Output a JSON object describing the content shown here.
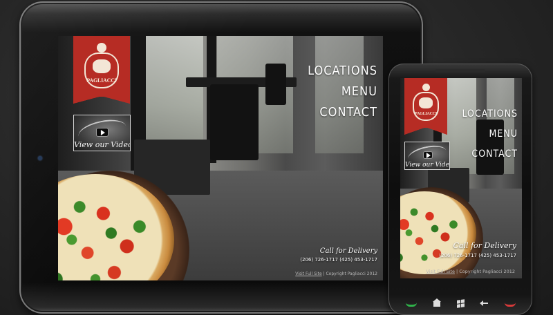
{
  "brand": {
    "name": "PAGLIACCI",
    "accent": "#b62c24"
  },
  "video": {
    "label": "View our Video",
    "icon": "play-icon"
  },
  "nav": {
    "items": [
      "LOCATIONS",
      "MENU",
      "CONTACT"
    ]
  },
  "delivery": {
    "title": "Call for Delivery",
    "phones": "(206) 726-1717  (425) 453-1717"
  },
  "footer": {
    "link": "Visit Full Site",
    "separator": " | ",
    "copyright": "Copyright Pagliacci 2012"
  },
  "phone_keys": [
    "call-icon",
    "home-icon",
    "windows-icon",
    "back-icon",
    "end-call-icon"
  ]
}
